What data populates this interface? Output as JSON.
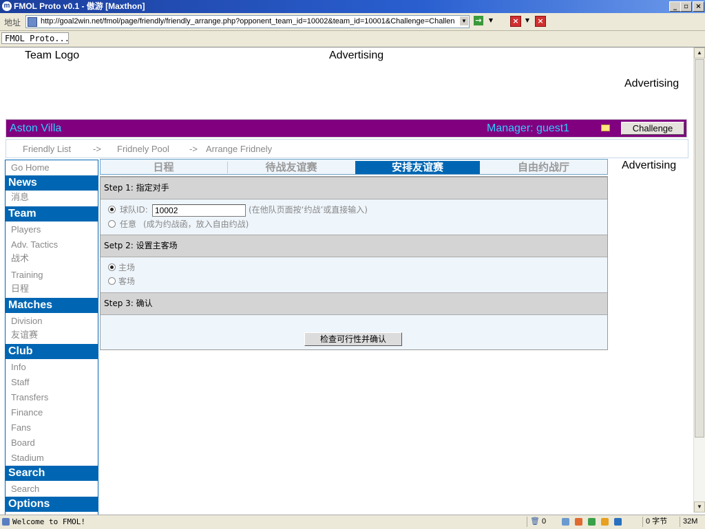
{
  "browser": {
    "title": "FMOL Proto v0.1 - 傲游 [Maxthon]",
    "address_label": "地址",
    "url": "http://goal2win.net/fmol/page/friendly/friendly_arrange.php?opponent_team_id=10002&team_id=10001&Challenge=Challen",
    "tab_label": "FMOL Proto...",
    "status_message": "Welcome to FMOL!",
    "status_count": "0",
    "status_bytes": "0 字节",
    "status_mem": "32M"
  },
  "header": {
    "team_logo": "Team Logo",
    "advertising_top": "Advertising",
    "advertising_right": "Advertising"
  },
  "teambar": {
    "team_name": "Aston Villa",
    "manager": "Manager: guest1",
    "challenge_label": "Challenge",
    "color": "#800080"
  },
  "breadcrumb": {
    "items": [
      "Friendly List",
      "Fridnely Pool",
      "Arrange Fridnely"
    ],
    "separator": "->"
  },
  "sidebar": {
    "go_home": "Go Home",
    "sections": [
      {
        "title": "News",
        "items": [
          "消息"
        ]
      },
      {
        "title": "Team",
        "items": [
          "Players",
          "Adv. Tactics",
          "战术",
          "Training",
          "日程"
        ]
      },
      {
        "title": "Matches",
        "items": [
          "Division",
          "友谊赛"
        ]
      },
      {
        "title": "Club",
        "items": [
          "Info",
          "Staff",
          "Transfers",
          "Finance",
          "Fans",
          "Board",
          "Stadium"
        ]
      },
      {
        "title": "Search",
        "items": [
          "Search"
        ]
      },
      {
        "title": "Options",
        "items": []
      }
    ]
  },
  "tabs": [
    "日程",
    "待战友谊赛",
    "安排友谊赛",
    "自由约战厅"
  ],
  "active_tab": "安排友谊赛",
  "side_advertising": "Advertising",
  "steps": {
    "step1": {
      "title": "Step 1: 指定对手",
      "option_team_id_label": "球队ID:",
      "team_id_value": "10002",
      "team_id_hint": "(在他队页面按‘约战’或直接输入)",
      "option_any_label": "任意",
      "option_any_hint": "(成为约战函，放入自由约战)"
    },
    "step2": {
      "title": "Setp 2: 设置主客场",
      "home": "主场",
      "away": "客场"
    },
    "step3": {
      "title": "Step 3: 确认",
      "confirm_label": "检查可行性并确认"
    }
  },
  "colors": {
    "accent_blue": "#0066b3",
    "team_name_color": "#33ccff",
    "panel_bg": "#eef5fb"
  }
}
